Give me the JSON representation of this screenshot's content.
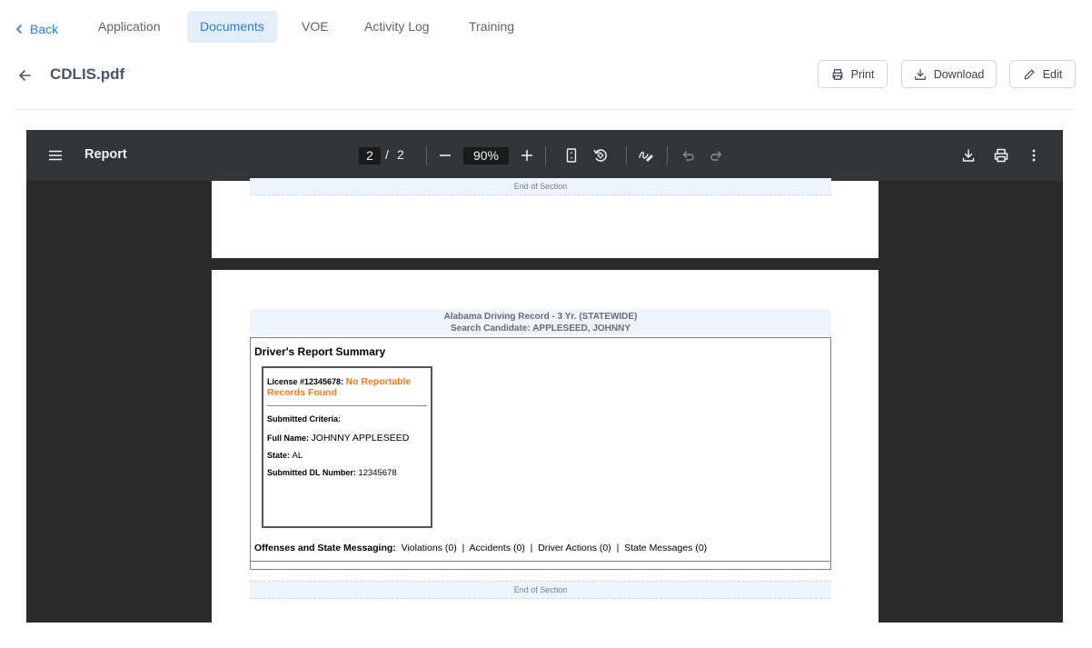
{
  "nav": {
    "back_label": "Back",
    "tabs": [
      {
        "label": "Application",
        "active": false
      },
      {
        "label": "Documents",
        "active": true
      },
      {
        "label": "VOE",
        "active": false
      },
      {
        "label": "Activity Log",
        "active": false
      },
      {
        "label": "Training",
        "active": false
      }
    ]
  },
  "header": {
    "filename": "CDLIS.pdf",
    "print_label": "Print",
    "download_label": "Download",
    "edit_label": "Edit"
  },
  "viewer": {
    "title": "Report",
    "current_page": "2",
    "page_separator": "/",
    "total_pages": "2",
    "zoom": "90%"
  },
  "document": {
    "end_of_section": "End of Section",
    "record_title": "Alabama Driving Record - 3 Yr.  (STATEWIDE)",
    "search_candidate": "Search Candidate: APPLESEED, JOHNNY",
    "summary_title": "Driver's Report Summary",
    "license_label": "License #12345678:",
    "license_status": "No Reportable Records Found",
    "criteria_heading": "Submitted Criteria:",
    "full_name_label": "Full Name:",
    "full_name": "JOHNNY APPLESEED",
    "state_label": "State:",
    "state": "AL",
    "dl_label": "Submitted DL Number:",
    "dl_number": "12345678",
    "offenses_label": "Offenses and State Messaging:",
    "offenses_values": "Violations (0)  |  Accidents (0)  |  Driver Actions (0)  |  State Messages (0)"
  },
  "colors": {
    "accent": "#2b7fd4",
    "active_tab_bg": "#e3eefa",
    "viewer_toolbar": "#323639",
    "viewer_bg": "#2b2b2b",
    "status_orange": "#f07a1e"
  }
}
